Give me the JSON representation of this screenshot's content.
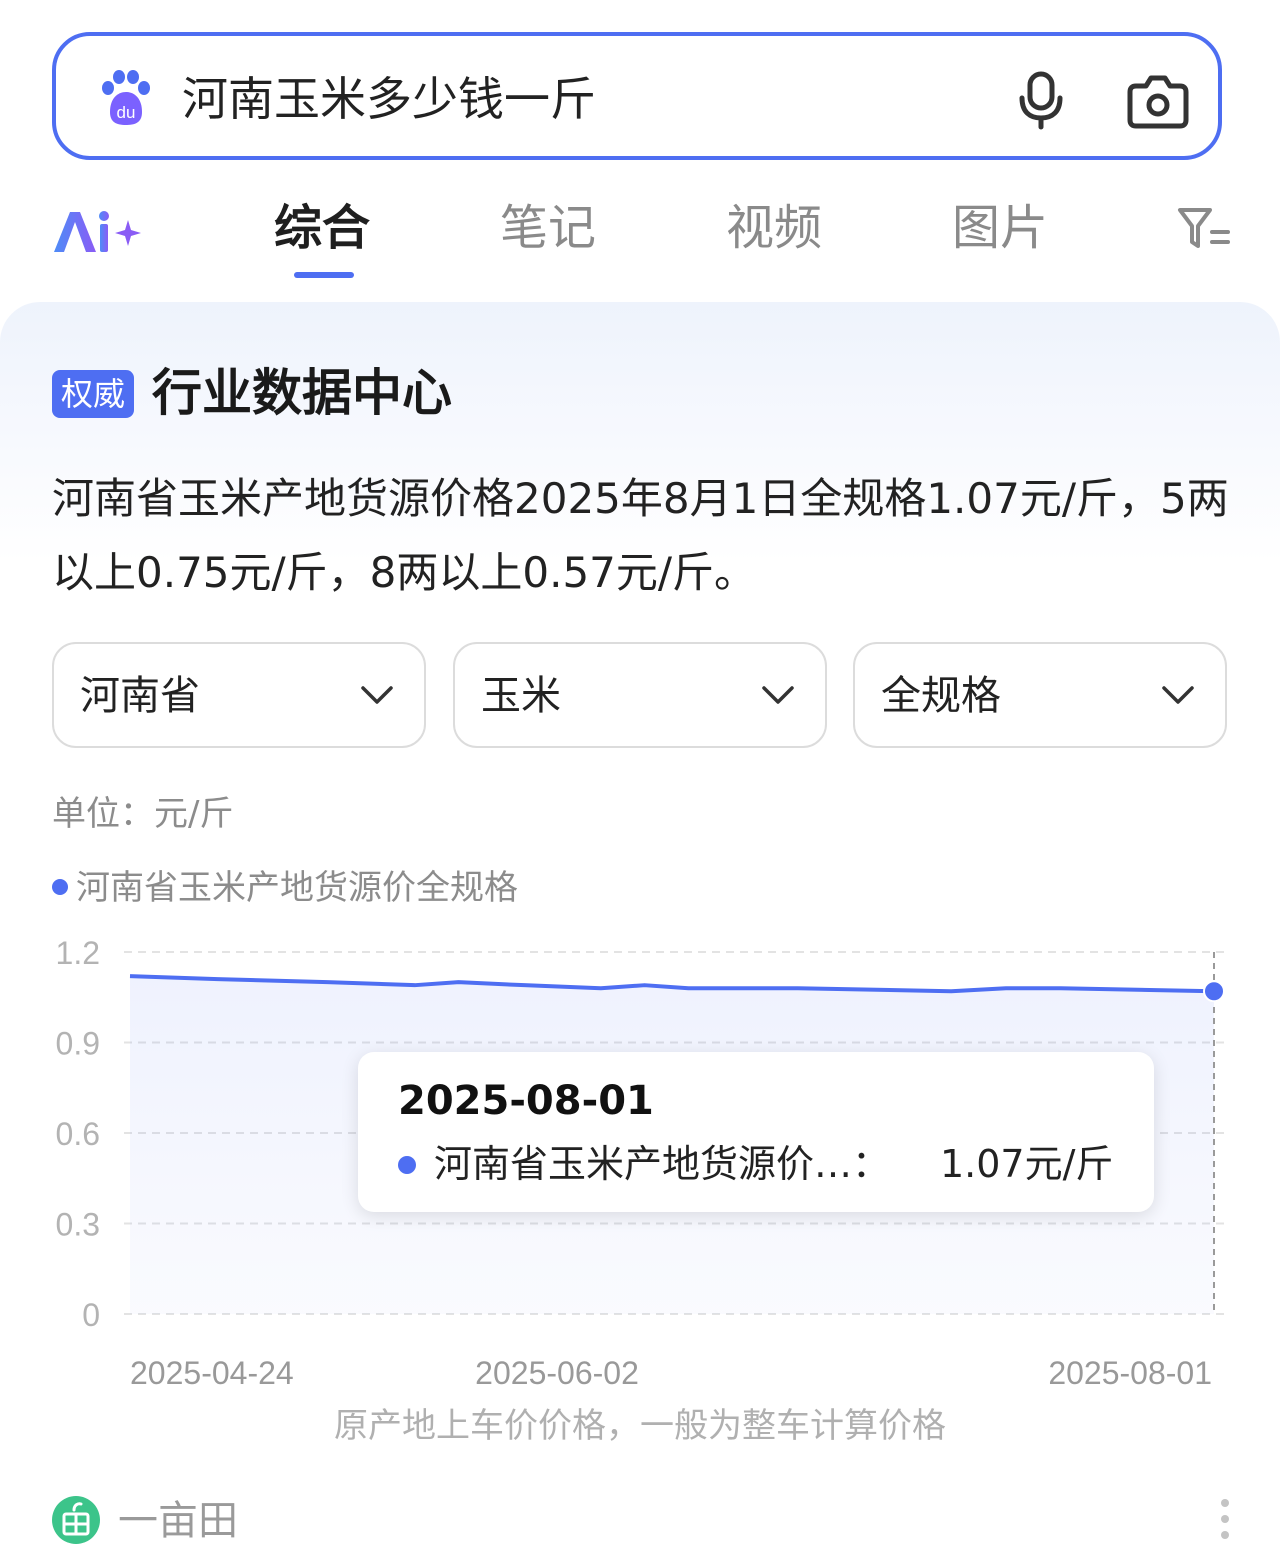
{
  "search": {
    "query": "河南玉米多少钱一斤"
  },
  "tabs": [
    {
      "label": "综合",
      "active": true
    },
    {
      "label": "笔记",
      "active": false
    },
    {
      "label": "视频",
      "active": false
    },
    {
      "label": "图片",
      "active": false
    }
  ],
  "card": {
    "badge": "权威",
    "title": "行业数据中心",
    "summary": "河南省玉米产地货源价格2025年8月1日全规格1.07元/斤，5两以上0.75元/斤，8两以上0.57元/斤。",
    "dropdowns": [
      "河南省",
      "玉米",
      "全规格"
    ],
    "unit": "单位：元/斤",
    "legend": "河南省玉米产地货源价全规格",
    "note": "原产地上车价价格，一般为整车计算价格",
    "tooltip": {
      "date": "2025-08-01",
      "series": "河南省玉米产地货源价…：",
      "value": "1.07元/斤"
    },
    "source": "一亩田"
  },
  "colors": {
    "accent": "#4e6ef2",
    "muted_text": "#8c8c8c"
  },
  "chart_data": {
    "type": "line",
    "x_tick_labels": [
      "2025-04-24",
      "2025-06-02",
      "2025-08-01"
    ],
    "y_ticks": [
      "1.2",
      "0.9",
      "0.6",
      "0.3",
      "0"
    ],
    "ylim": [
      0,
      1.2
    ],
    "xlim": [
      "2025-04-24",
      "2025-08-01"
    ],
    "grid": true,
    "series": [
      {
        "name": "河南省玉米产地货源价全规格",
        "x": [
          "2025-04-24",
          "2025-05-02",
          "2025-05-12",
          "2025-05-20",
          "2025-05-24",
          "2025-05-30",
          "2025-06-06",
          "2025-06-10",
          "2025-06-14",
          "2025-06-24",
          "2025-07-08",
          "2025-07-13",
          "2025-07-18",
          "2025-08-01"
        ],
        "values": [
          1.12,
          1.11,
          1.1,
          1.09,
          1.1,
          1.09,
          1.08,
          1.09,
          1.08,
          1.08,
          1.07,
          1.08,
          1.08,
          1.07
        ]
      }
    ],
    "highlight": {
      "x": "2025-08-01",
      "value": 1.07
    }
  }
}
